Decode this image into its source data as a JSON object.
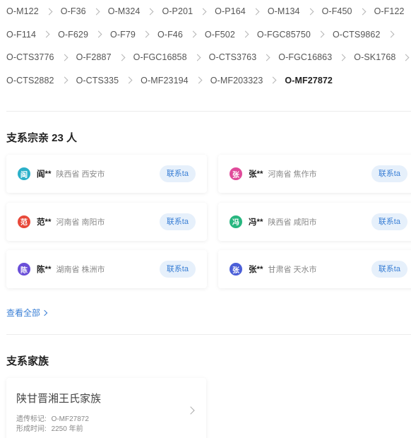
{
  "breadcrumb": [
    "O-M122",
    "O-F36",
    "O-M324",
    "O-P201",
    "O-P164",
    "O-M134",
    "O-F450",
    "O-F122",
    "O-F114",
    "O-F629",
    "O-F79",
    "O-F46",
    "O-F502",
    "O-FGC85750",
    "O-CTS9862",
    "O-CTS3776",
    "O-F2887",
    "O-FGC16858",
    "O-CTS3763",
    "O-FGC16863",
    "O-SK1768",
    "O-CTS2882",
    "O-CTS335",
    "O-MF23194",
    "O-MF203323",
    "O-MF27872"
  ],
  "relatives": {
    "title": "支系宗亲 23 人",
    "view_all": "查看全部",
    "contact_label": "联系ta",
    "items": [
      {
        "avatar": "阎",
        "name": "阎**",
        "location": "陕西省 西安市",
        "color": "#2bb0c9"
      },
      {
        "avatar": "张",
        "name": "张**",
        "location": "河南省 焦作市",
        "color": "#e04a9a"
      },
      {
        "avatar": "范",
        "name": "范**",
        "location": "河南省 南阳市",
        "color": "#e8493a"
      },
      {
        "avatar": "冯",
        "name": "冯**",
        "location": "陕西省 咸阳市",
        "color": "#27b67f"
      },
      {
        "avatar": "陈",
        "name": "陈**",
        "location": "湖南省 株洲市",
        "color": "#6a4fd8"
      },
      {
        "avatar": "张",
        "name": "张**",
        "location": "甘肃省 天水市",
        "color": "#4b5fd8"
      }
    ]
  },
  "clans": {
    "title": "支系家族",
    "items": [
      {
        "name": "陕甘晋湘王氏家族",
        "marker_label": "遗传标记:",
        "marker": "O-MF27872",
        "formed_label": "形成时间:",
        "formed": "2250 年前"
      }
    ]
  }
}
